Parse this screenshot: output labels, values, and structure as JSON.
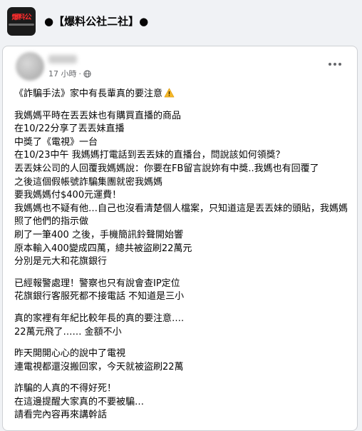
{
  "group": {
    "logo_text": "爆料公",
    "name": "●【爆料公社二社】●"
  },
  "post": {
    "time": "17 小時",
    "separator": "·",
    "title": "《詐騙手法》家中有長輩真的要注意",
    "paragraphs": [
      [
        "我媽媽平時在丟丟妹也有購買直播的商品",
        "在10/22分享了丟丟妹直播",
        "中獎了《電視》一台",
        "在10/23中午 我媽媽打電話到丟丟妹的直播台，問說該如何領獎？",
        "丟丟妹公司的人回覆我媽媽說：你要在FB留言說妳有中獎..我媽也有回覆了",
        "之後這個假帳號詐騙集團就密我媽媽",
        "要我媽媽付$400元運費！",
        "我媽媽也不疑有他…自己也沒看清楚個人檔案，只知道這是丟丟妹的頭貼，我媽媽照了他們的指示做",
        "刷了一筆400 之後，手機簡訊鈴聲開始響",
        "原本輸入400變成四萬，總共被盜刷22萬元",
        "分別是元大和花旗銀行"
      ],
      [
        "已經報警處理！警察也只有說會查IP定位",
        "花旗銀行客服死都不接電話 不知道是三小"
      ],
      [
        "真的家裡有年紀比較年長的真的要注意….",
        "22萬元飛了…… 金額不小"
      ],
      [
        "昨天開開心心的說中了電視",
        "連電視都還沒搬回家，今天就被盜刷22萬"
      ],
      [
        "詐騙的人真的不得好死！",
        "在這邊提醒大家真的不要被騙…",
        "請看完內容再來講幹話"
      ]
    ]
  },
  "colors": {
    "page_bg": "#f0f2f5",
    "card_bg": "#ffffff",
    "secondary_text": "#65676b",
    "warning_yellow": "#f7b928"
  },
  "icons": {
    "visibility": "globe-icon",
    "menu": "more-options-icon",
    "title_emoji": "warning-icon"
  }
}
